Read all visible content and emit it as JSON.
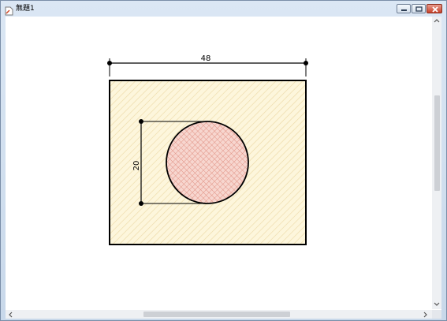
{
  "window": {
    "title": "無題1"
  },
  "drawing": {
    "width_dimension": "48",
    "diameter_dimension": "20",
    "colors": {
      "rect_fill": "#fdf6dc",
      "rect_hatch": "#ecd8a4",
      "circle_fill": "#f7d6cf",
      "circle_hatch": "#df8b7d",
      "line": "#000000"
    }
  },
  "icons": {
    "app": "document-icon",
    "minimize": "minimize-icon",
    "maximize": "maximize-icon",
    "close": "close-icon"
  }
}
